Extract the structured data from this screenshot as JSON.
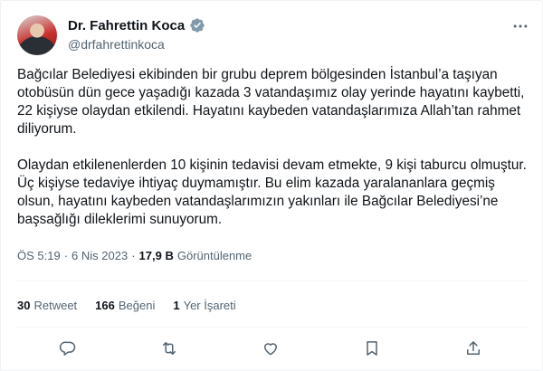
{
  "author": {
    "display_name": "Dr. Fahrettin Koca",
    "handle": "@drfahrettinkoca",
    "verified": true
  },
  "tweet": {
    "paragraphs": [
      "Bağcılar Belediyesi ekibinden bir grubu deprem bölgesinden İstanbul’a taşıyan otobüsün dün gece yaşadığı kazada 3 vatandaşımız olay yerinde hayatını kaybetti, 22 kişiyse olaydan etkilendi. Hayatını kaybeden vatandaşlarımıza Allah’tan rahmet diliyorum.",
      "Olaydan etkilenenlerden 10 kişinin tedavisi devam etmekte, 9 kişi taburcu olmuştur. Üç kişiyse tedaviye ihtiyaç duymamıştır. Bu elim kazada yaralananlara geçmiş olsun, hayatını kaybeden vatandaşlarımızın yakınları ile Bağcılar Belediyesi’ne başsağlığı dileklerimi sunuyorum."
    ]
  },
  "meta": {
    "time": "ÖS 5:19",
    "separator": "·",
    "date": "6 Nis 2023",
    "views_count": "17,9 B",
    "views_label": "Görüntülenme"
  },
  "stats": {
    "retweets_count": "30",
    "retweets_label": "Retweet",
    "likes_count": "166",
    "likes_label": "Beğeni",
    "bookmarks_count": "1",
    "bookmarks_label": "Yer İşareti"
  },
  "icons": {
    "more": "more-icon",
    "verified": "verified-badge-icon",
    "reply": "reply-icon",
    "retweet": "retweet-icon",
    "like": "like-icon",
    "bookmark": "bookmark-icon",
    "share": "share-icon"
  },
  "colors": {
    "text": "#0f1419",
    "secondary": "#536471",
    "verified": "#829aab",
    "divider": "#eff3f4"
  }
}
